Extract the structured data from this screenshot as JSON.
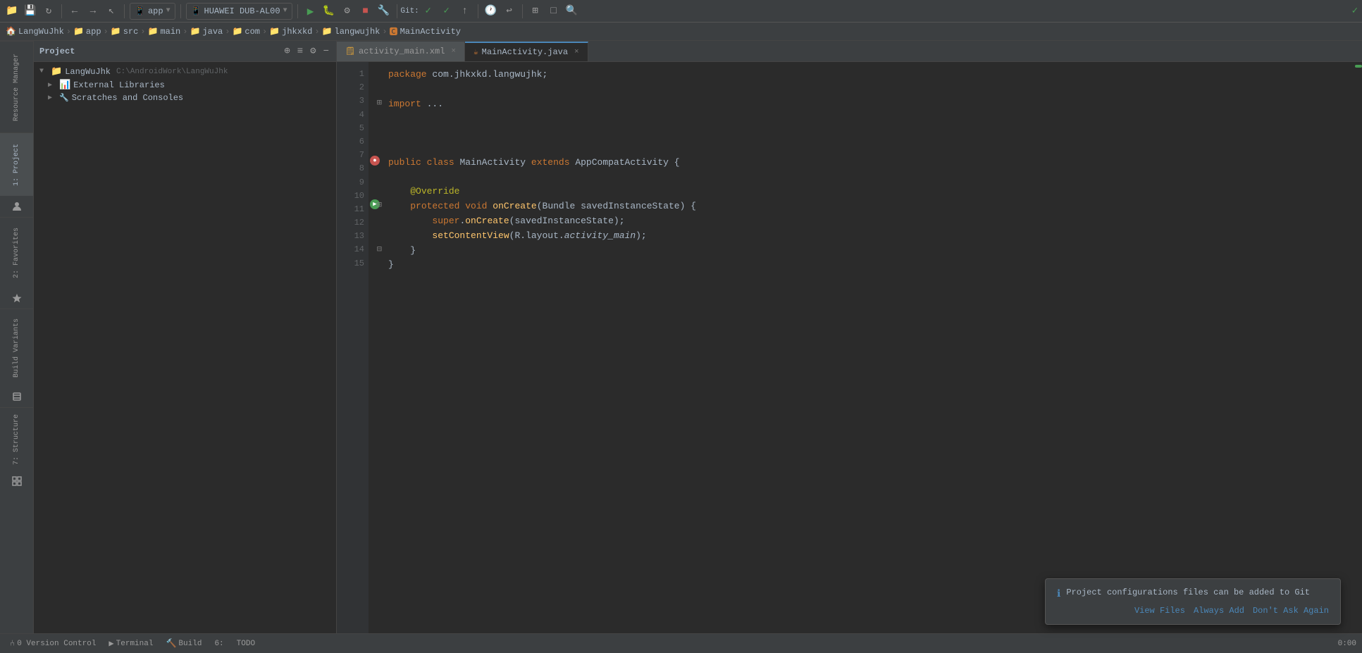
{
  "toolbar": {
    "items": [
      {
        "name": "open-folder",
        "icon": "📁"
      },
      {
        "name": "save",
        "icon": "💾"
      },
      {
        "name": "sync",
        "icon": "↻"
      },
      {
        "name": "back",
        "icon": "←"
      },
      {
        "name": "forward",
        "icon": "→"
      },
      {
        "name": "cursor",
        "icon": "↖"
      }
    ],
    "app_dropdown": {
      "label": "app",
      "icon": "📱"
    },
    "device_dropdown": {
      "label": "HUAWEI DUB-AL00",
      "icon": "📱"
    }
  },
  "breadcrumb": {
    "items": [
      {
        "label": "LangWuJhk",
        "type": "project"
      },
      {
        "label": "app",
        "type": "folder"
      },
      {
        "label": "src",
        "type": "folder"
      },
      {
        "label": "main",
        "type": "folder"
      },
      {
        "label": "java",
        "type": "folder"
      },
      {
        "label": "com",
        "type": "folder"
      },
      {
        "label": "jhkxkd",
        "type": "folder"
      },
      {
        "label": "langwujhk",
        "type": "folder"
      },
      {
        "label": "MainActivity",
        "type": "class"
      }
    ]
  },
  "project_panel": {
    "title": "Project",
    "tree": [
      {
        "label": "LangWuJhk",
        "path": "C:\\AndroidWork\\LangWuJhk",
        "indent": 0,
        "type": "project",
        "expanded": true
      },
      {
        "label": "External Libraries",
        "indent": 1,
        "type": "library",
        "expanded": false
      },
      {
        "label": "Scratches and Consoles",
        "indent": 1,
        "type": "scratch",
        "expanded": false
      }
    ]
  },
  "tabs": [
    {
      "label": "activity_main.xml",
      "type": "xml",
      "active": false
    },
    {
      "label": "MainActivity.java",
      "type": "java",
      "active": true
    }
  ],
  "editor": {
    "lines": [
      {
        "num": 1,
        "code": "package com.jhkxkd.langwujhk;",
        "type": "package"
      },
      {
        "num": 2,
        "code": "",
        "type": "blank"
      },
      {
        "num": 3,
        "code": "⊞import ..."
      },
      {
        "num": 4,
        "code": "",
        "type": "blank"
      },
      {
        "num": 5,
        "code": "",
        "type": "blank"
      },
      {
        "num": 6,
        "code": "",
        "type": "blank"
      },
      {
        "num": 7,
        "code": "public class MainActivity extends AppCompatActivity {"
      },
      {
        "num": 8,
        "code": "",
        "type": "blank"
      },
      {
        "num": 9,
        "code": "    @Override"
      },
      {
        "num": 10,
        "code": "    ⊟protected void onCreate(Bundle savedInstanceState) {"
      },
      {
        "num": 11,
        "code": "        super.onCreate(savedInstanceState);"
      },
      {
        "num": 12,
        "code": "        setContentView(R.layout.activity_main);"
      },
      {
        "num": 13,
        "code": "    ⊟}"
      },
      {
        "num": 14,
        "code": "}"
      },
      {
        "num": 15,
        "code": ""
      }
    ]
  },
  "side_tabs": {
    "left": [
      {
        "label": "Resource Manager"
      },
      {
        "label": "1: Project"
      },
      {
        "label": "2: Favorites"
      },
      {
        "label": "Build Variants"
      },
      {
        "label": "7: Structure"
      }
    ]
  },
  "notification": {
    "text": "Project configurations files can be added to Git",
    "actions": [
      {
        "label": "View Files"
      },
      {
        "label": "Always Add"
      },
      {
        "label": "Don't Ask Again"
      }
    ]
  },
  "status_bar": {
    "items": [
      {
        "label": "0 Version Control"
      },
      {
        "label": "Terminal"
      },
      {
        "label": "Build"
      },
      {
        "label": "6:"
      },
      {
        "label": "TODO"
      }
    ],
    "time": "0:00"
  }
}
